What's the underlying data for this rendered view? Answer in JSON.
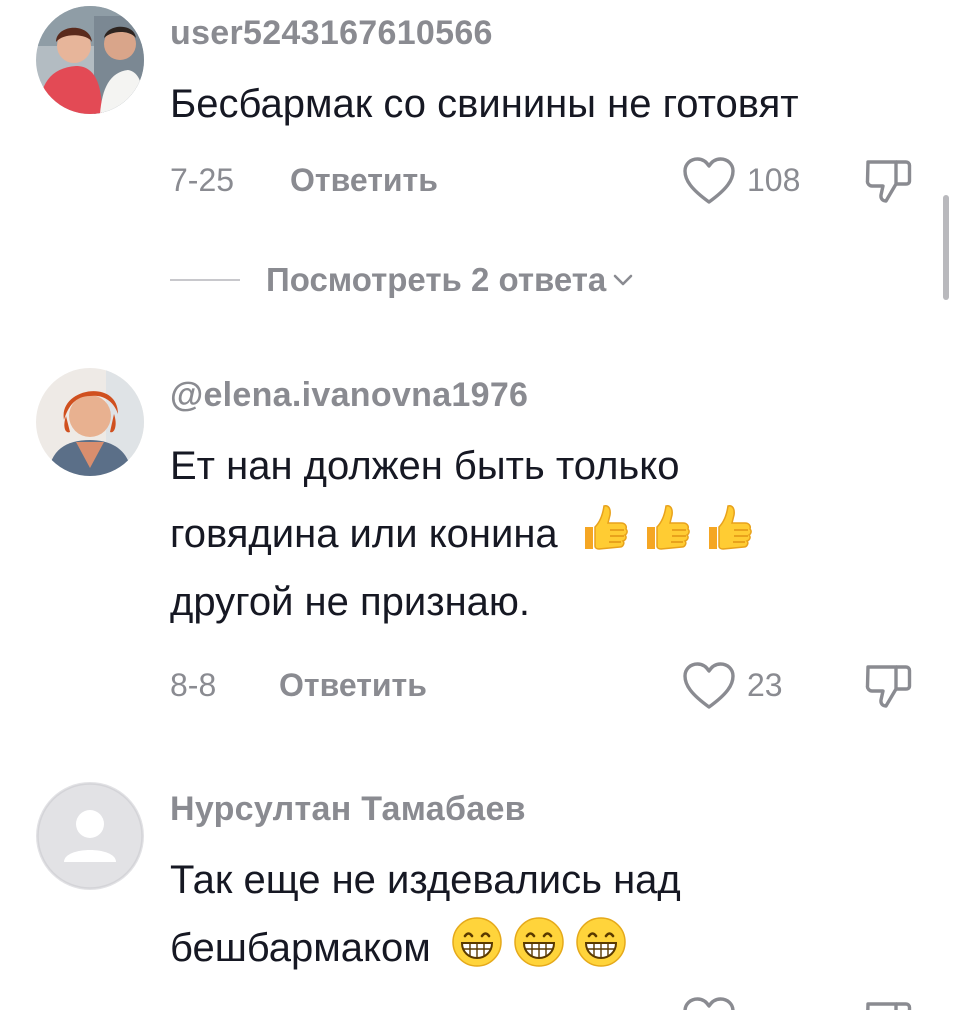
{
  "comments": [
    {
      "username": "user5243167610566",
      "text_lines": [
        "Бесбармак со свинины не готовят"
      ],
      "date": "7-25",
      "reply_label": "Ответить",
      "likes": "108",
      "view_replies": "Посмотреть 2 ответа"
    },
    {
      "username": "@elena.ivanovna1976",
      "text_lines": [
        "Ет нан должен быть только",
        "говядина или конина",
        "другой не признаю."
      ],
      "emoji": [
        "thumbs-up",
        "thumbs-up",
        "thumbs-up"
      ],
      "date": "8-8",
      "reply_label": "Ответить",
      "likes": "23"
    },
    {
      "username": "Нурсултан Тамабаев",
      "text_lines": [
        "Так еще не издевались над",
        "бешбармаком"
      ],
      "emoji": [
        "grinning-face",
        "grinning-face",
        "grinning-face"
      ]
    }
  ],
  "colors": {
    "text_primary": "#161823",
    "text_secondary": "#8a8b91",
    "background": "#ffffff"
  }
}
